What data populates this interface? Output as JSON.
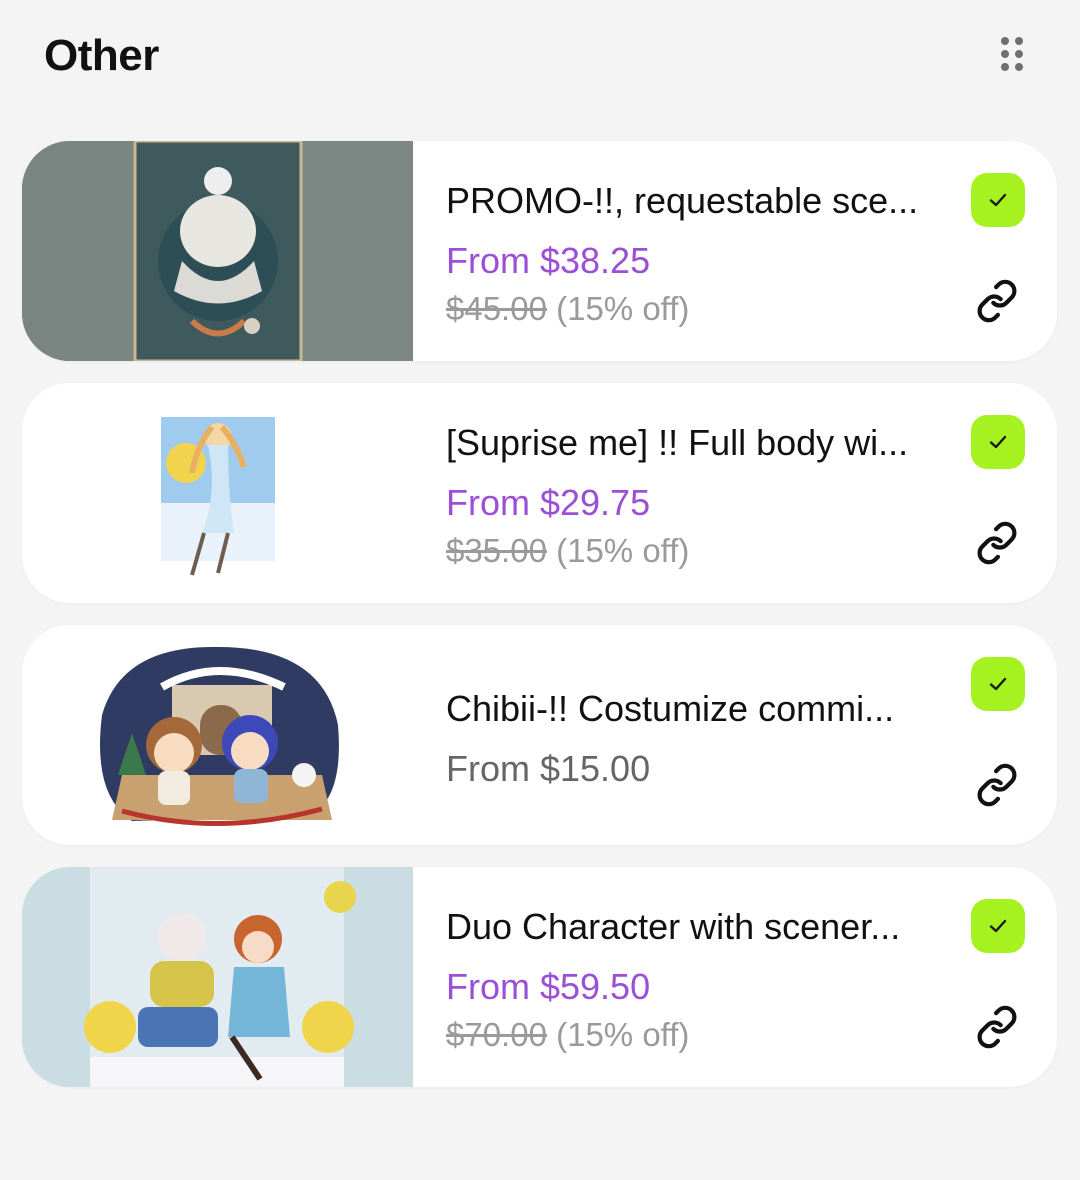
{
  "section": {
    "title": "Other"
  },
  "colors": {
    "accent_price": "#9b4fd6",
    "check_bg": "#a6f221",
    "card_bg": "#ffffff",
    "page_bg": "#f4f4f4"
  },
  "items": [
    {
      "title": "PROMO-!!, requestable sce...",
      "price": "From $38.25",
      "original_price": "$45.00",
      "discount": "(15% off)",
      "selected": true,
      "icons": [
        "check-icon",
        "link-icon"
      ]
    },
    {
      "title": "[Suprise me] !! Full body wi...",
      "price": "From $29.75",
      "original_price": "$35.00",
      "discount": "(15% off)",
      "selected": true,
      "icons": [
        "check-icon",
        "link-icon"
      ]
    },
    {
      "title": "Chibii-!! Costumize commi...",
      "price": "From $15.00",
      "selected": true,
      "icons": [
        "check-icon",
        "link-icon"
      ]
    },
    {
      "title": "Duo Character with scener...",
      "price": "From $59.50",
      "original_price": "$70.00",
      "discount": "(15% off)",
      "selected": true,
      "icons": [
        "check-icon",
        "link-icon"
      ]
    }
  ]
}
